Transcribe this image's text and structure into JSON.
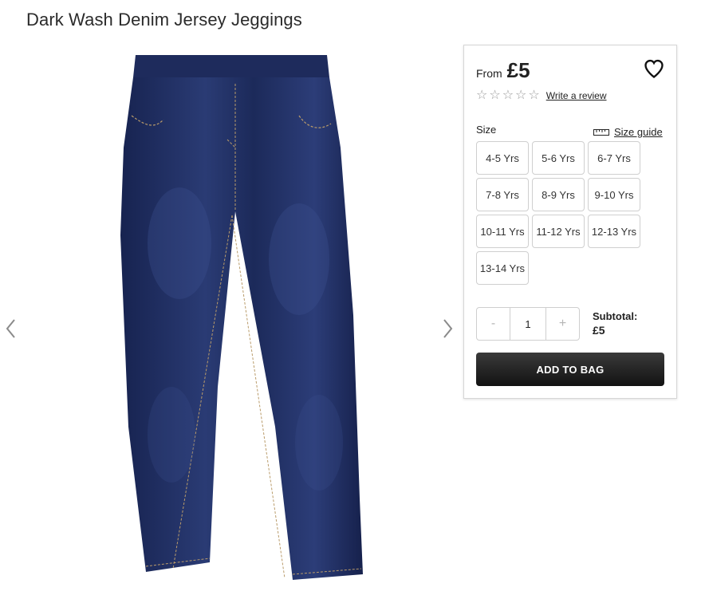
{
  "product": {
    "title": "Dark Wash Denim Jersey Jeggings",
    "image_icon": "jeggings-product-image"
  },
  "gallery": {
    "prev_icon": "chevron-left-icon",
    "next_icon": "chevron-right-icon"
  },
  "price": {
    "prefix": "From",
    "value": "£5"
  },
  "wishlist": {
    "icon": "heart-icon"
  },
  "rating": {
    "stars": 0,
    "max_stars": 5,
    "review_link": "Write a review"
  },
  "size": {
    "label": "Size",
    "guide_label": "Size guide",
    "guide_icon": "ruler-icon",
    "options": [
      "4-5 Yrs",
      "5-6 Yrs",
      "6-7 Yrs",
      "7-8 Yrs",
      "8-9 Yrs",
      "9-10 Yrs",
      "10-11 Yrs",
      "11-12 Yrs",
      "12-13 Yrs",
      "13-14 Yrs"
    ]
  },
  "quantity": {
    "minus": "-",
    "value": "1",
    "plus": "+"
  },
  "subtotal": {
    "label": "Subtotal:",
    "amount": "£5"
  },
  "cart": {
    "add_label": "ADD TO BAG"
  },
  "colors": {
    "denim": "#1c2a5a",
    "button_dark": "#1a1a1a",
    "border": "#cfcfcf"
  }
}
